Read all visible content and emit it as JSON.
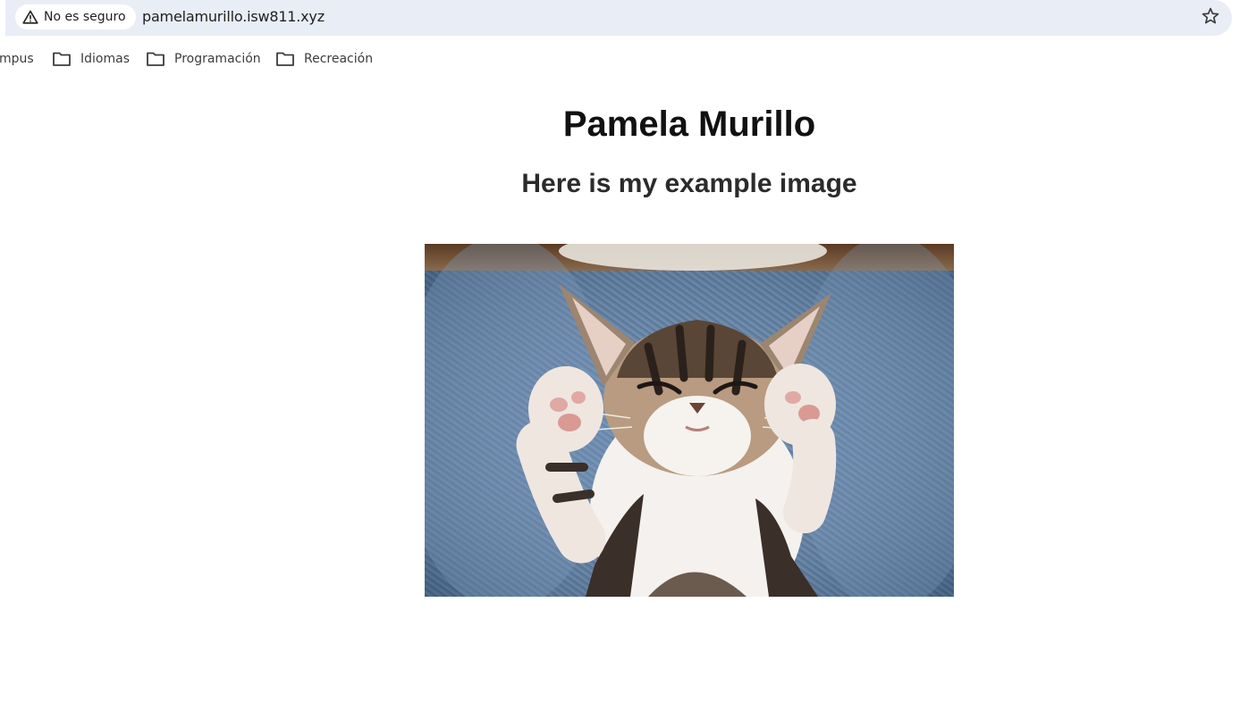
{
  "browser": {
    "security_label": "No es seguro",
    "url": "pamelamurillo.isw811.xyz",
    "star_icon": "star-icon",
    "warning_icon": "warning-triangle-icon"
  },
  "bookmarks": [
    {
      "label": "mpus",
      "icon": "folder-icon"
    },
    {
      "label": "Idiomas",
      "icon": "folder-icon"
    },
    {
      "label": "Programación",
      "icon": "folder-icon"
    },
    {
      "label": "Recreación",
      "icon": "folder-icon"
    }
  ],
  "page": {
    "title": "Pamela Murillo",
    "subtitle": "Here is my example image"
  },
  "colors": {
    "omnibox_bg": "#e9edf6",
    "text": "#1f1f1f",
    "denim": "#5f7fa3"
  }
}
